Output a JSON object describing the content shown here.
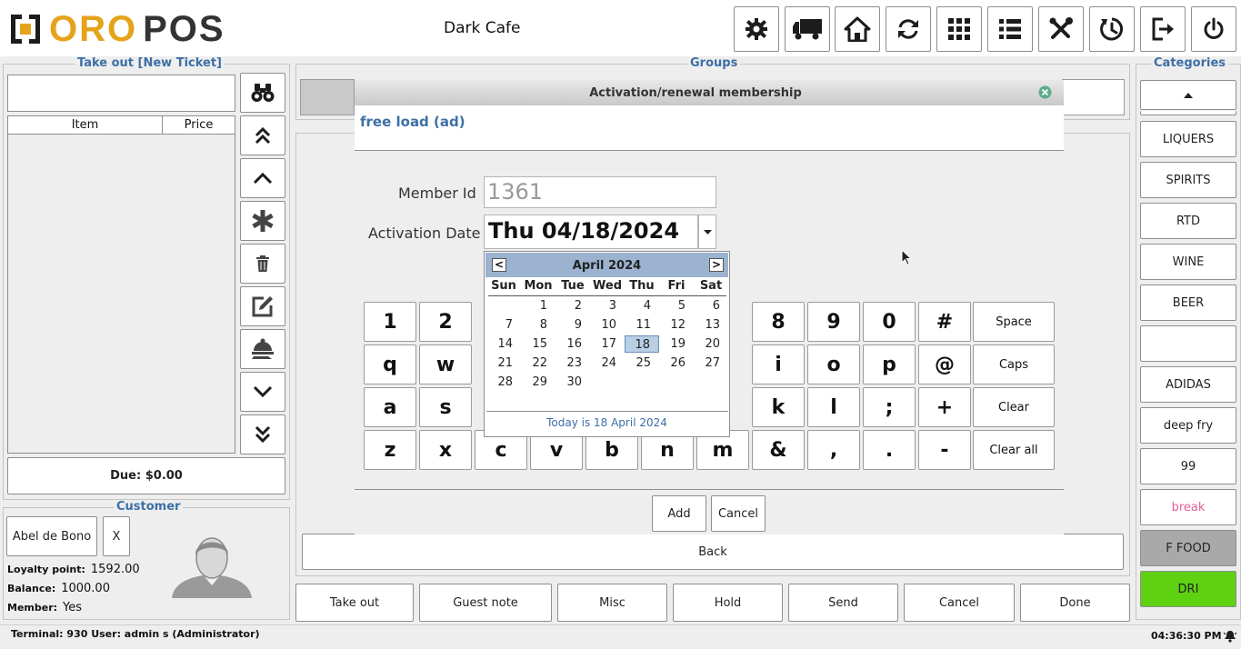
{
  "app": {
    "logo_left": "ORO",
    "logo_right": "POS",
    "store_name": "Dark Cafe"
  },
  "toolbar": {
    "icons": [
      "gear-icon",
      "truck-icon",
      "home-icon",
      "refresh-icon",
      "grid-icon",
      "list-icon",
      "tools-icon",
      "clock-icon",
      "logout-icon",
      "power-icon"
    ]
  },
  "ticket": {
    "title": "Take out [New Ticket]",
    "search_value": "",
    "col_item": "Item",
    "col_price": "Price",
    "due": "Due: $0.00"
  },
  "customer": {
    "title": "Customer",
    "name": "Abel de Bono",
    "remove": "X",
    "loyalty_label": "Loyalty point:",
    "loyalty_value": "1592.00",
    "balance_label": "Balance:",
    "balance_value": "1000.00",
    "member_label": "Member:",
    "member_value": "Yes"
  },
  "groups": {
    "title": "Groups",
    "back": "Back"
  },
  "categories": {
    "title": "Categories",
    "items": [
      "LIQUERS",
      "SPIRITS",
      "RTD",
      "WINE",
      "BEER",
      "",
      "ADIDAS",
      "deep fry",
      "99",
      "break",
      "F FOOD",
      "DRI"
    ],
    "colors": {
      "break_text": "#e0609a",
      "ffood_bg": "#a9a9a9",
      "dri_bg": "#5ed113"
    }
  },
  "dialog": {
    "title": "Activation/renewal membership",
    "subtitle": "free load (ad)",
    "member_id_label": "Member Id",
    "member_id_value": "1361",
    "activation_label": "Activation Date",
    "activation_value": "Thu 04/18/2024",
    "add": "Add",
    "cancel": "Cancel"
  },
  "calendar": {
    "month": "April 2024",
    "prev": "<",
    "next": ">",
    "weekdays": [
      "Sun",
      "Mon",
      "Tue",
      "Wed",
      "Thu",
      "Fri",
      "Sat"
    ],
    "weeks": [
      [
        "",
        "1",
        "2",
        "3",
        "4",
        "5",
        "6"
      ],
      [
        "7",
        "8",
        "9",
        "10",
        "11",
        "12",
        "13"
      ],
      [
        "14",
        "15",
        "16",
        "17",
        "18",
        "19",
        "20"
      ],
      [
        "21",
        "22",
        "23",
        "24",
        "25",
        "26",
        "27"
      ],
      [
        "28",
        "29",
        "30",
        "",
        "",
        "",
        ""
      ]
    ],
    "selected": "18",
    "today": "Today is  18 April 2024"
  },
  "keyboard": {
    "row1": [
      "1",
      "2",
      "",
      "",
      "",
      "",
      "",
      "8",
      "9",
      "0",
      "#",
      "Space"
    ],
    "row2": [
      "q",
      "w",
      "",
      "",
      "",
      "",
      "",
      "i",
      "o",
      "p",
      "@",
      "Caps"
    ],
    "row3": [
      "a",
      "s",
      "",
      "",
      "",
      "",
      "",
      "k",
      "l",
      ";",
      "+",
      "Clear"
    ],
    "row4": [
      "z",
      "x",
      "c",
      "v",
      "b",
      "n",
      "m",
      "&",
      ",",
      ".",
      "-",
      "Clear all"
    ]
  },
  "bottom": [
    "Take out",
    "Guest note",
    "Misc",
    "Hold",
    "Send",
    "Cancel",
    "Done"
  ],
  "status": {
    "left": "Terminal: 930 User: admin s (Administrator)",
    "time": "04:36:30 PM"
  }
}
